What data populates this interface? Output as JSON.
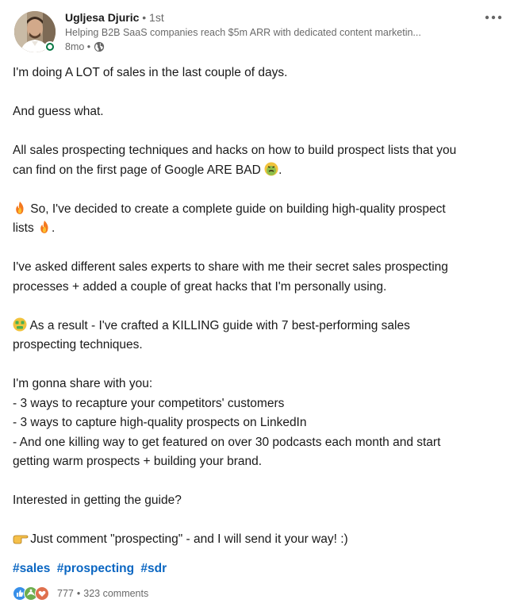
{
  "author": {
    "name": "Ugljesa Djuric",
    "degree": "• 1st",
    "headline": "Helping B2B SaaS companies reach $5m ARR with dedicated content marketin...",
    "time": "8mo •",
    "visibility_icon": "globe-icon",
    "status": "online"
  },
  "post": {
    "p1": "I'm doing A LOT of sales in the last couple of days.",
    "p2": "And guess what.",
    "p3_l1": "All sales prospecting techniques and hacks on how to build prospect lists that you",
    "p3_l2": "can find on the first page of Google ARE BAD",
    "p3_l2_end": ".",
    "p4_l1": " So, I've decided to create a complete guide on building high-quality prospect",
    "p4_l2": "lists ",
    "p4_l2_end": ".",
    "p5_l1": "I've asked different sales experts to share with me their secret sales prospecting",
    "p5_l2": "processes + added a couple of great hacks that I'm personally using.",
    "p6_l1": " As a result - I've crafted a KILLING guide with 7 best-performing sales",
    "p6_l2": "prospecting techniques.",
    "p7_l1": "I'm gonna share with you:",
    "p7_l2": "- 3 ways to recapture your competitors' customers",
    "p7_l3": "- 3 ways to capture high-quality prospects on LinkedIn",
    "p7_l4": "- And one killing way to get featured on over 30 podcasts each month and start",
    "p7_l5": "getting warm prospects + building your brand.",
    "p8": "Interested in getting the guide?",
    "p9": " Just comment \"prospecting\" - and I will send it your way! :)"
  },
  "hashtags": [
    "#sales",
    "#prospecting",
    "#sdr"
  ],
  "social": {
    "reaction_icons": [
      "like-icon",
      "support-icon",
      "love-icon"
    ],
    "reaction_count": "777",
    "separator": "•",
    "comments": "323 comments"
  },
  "colors": {
    "link": "#0a66c2",
    "online": "#057642",
    "like": "#378fe9",
    "support": "#6dae4f",
    "love": "#df704d"
  }
}
